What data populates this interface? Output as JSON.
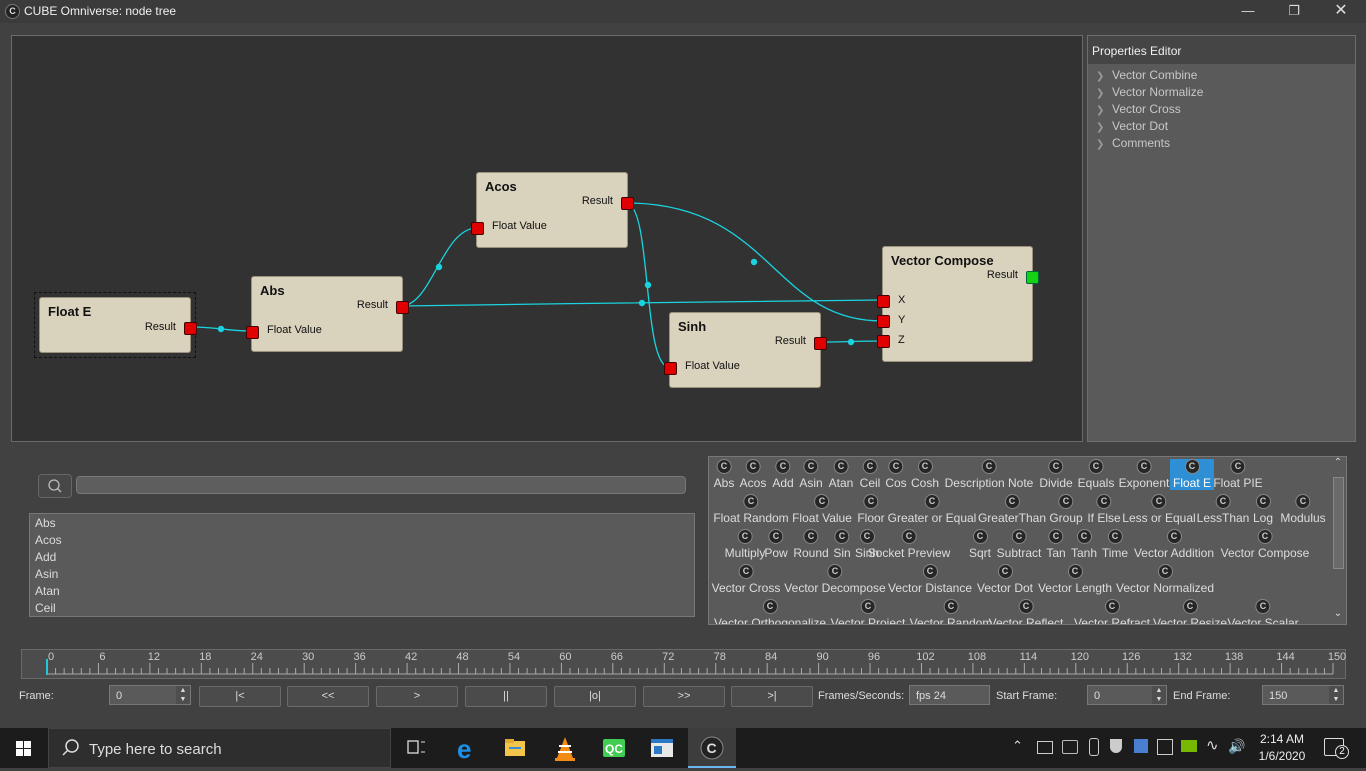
{
  "window": {
    "title": "CUBE Omniverse: node tree",
    "icon": "C"
  },
  "graph": {
    "nodes": {
      "float_e": {
        "title": "Float E",
        "result": "Result"
      },
      "abs": {
        "title": "Abs",
        "result": "Result",
        "input": "Float Value"
      },
      "acos": {
        "title": "Acos",
        "result": "Result",
        "input": "Float Value"
      },
      "sinh": {
        "title": "Sinh",
        "result": "Result",
        "input": "Float Value"
      },
      "vector_compose": {
        "title": "Vector Compose",
        "result": "Result",
        "x": "X",
        "y": "Y",
        "z": "Z"
      }
    }
  },
  "properties": {
    "title": "Properties Editor",
    "items": [
      "Vector Combine",
      "Vector Normalize",
      "Vector Cross",
      "Vector Dot",
      "Comments"
    ]
  },
  "node_list": {
    "items": [
      "Abs",
      "Acos",
      "Add",
      "Asin",
      "Atan",
      "Ceil"
    ]
  },
  "palette": {
    "selected": "Float E",
    "rows": [
      [
        "Abs",
        "Acos",
        "Add",
        "Asin",
        "Atan",
        "Ceil",
        "Cos",
        "Cosh",
        "Description Note",
        "Divide",
        "Equals",
        "Exponent",
        "Float E",
        "Float PIE"
      ],
      [
        "Float Random",
        "Float Value",
        "Floor",
        "Greater or Equal",
        "GreaterThan",
        "Group",
        "If Else",
        "Less or Equal",
        "LessThan",
        "Log",
        "Modulus"
      ],
      [
        "Multiply",
        "Pow",
        "Round",
        "Sin",
        "Sinh",
        "Socket Preview",
        "Sqrt",
        "Subtract",
        "Tan",
        "Tanh",
        "Time",
        "Vector Addition",
        "Vector Compose"
      ],
      [
        "Vector Cross",
        "Vector Decompose",
        "Vector Distance",
        "Vector Dot",
        "Vector Length",
        "Vector Normalized"
      ],
      [
        "Vector Orthogonalize",
        "Vector Project",
        "Vector Random",
        "Vector Reflect",
        "Vector Refract",
        "Vector Resize",
        "Vector Scalar"
      ]
    ]
  },
  "timeline": {
    "labels": [
      "0",
      "6",
      "12",
      "18",
      "24",
      "30",
      "36",
      "42",
      "48",
      "54",
      "60",
      "66",
      "72",
      "78",
      "84",
      "90",
      "96",
      "102",
      "108",
      "114",
      "120",
      "126",
      "132",
      "138",
      "144",
      "150"
    ],
    "current_frame": 0
  },
  "controls": {
    "frame_label": "Frame:",
    "frame_value": "0",
    "buttons": [
      "|<",
      "<<",
      ">",
      "||",
      "|o|",
      ">>",
      ">|"
    ],
    "fps_label": "Frames/Seconds:",
    "fps_value": "fps 24",
    "start_label": "Start Frame:",
    "start_value": "0",
    "end_label": "End Frame:",
    "end_value": "150"
  },
  "taskbar": {
    "search_placeholder": "Type here to search",
    "time": "2:14 AM",
    "date": "1/6/2020",
    "notifications": "2"
  }
}
